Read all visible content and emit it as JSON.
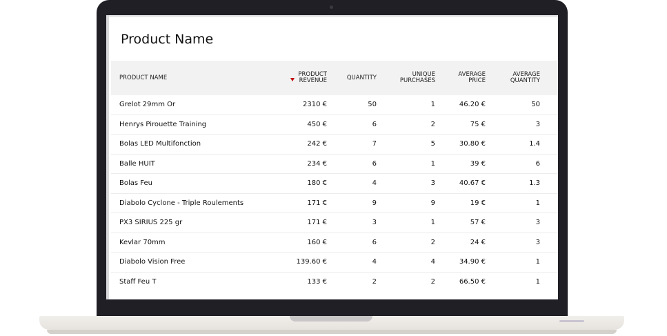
{
  "report": {
    "title": "Product Name",
    "sorted_column": "product_revenue",
    "sort_direction": "desc",
    "sort_indicator_color": "#c00000",
    "columns": [
      {
        "key": "name",
        "label": "PRODUCT NAME"
      },
      {
        "key": "revenue",
        "label": "PRODUCT\nREVENUE"
      },
      {
        "key": "quantity",
        "label": "QUANTITY"
      },
      {
        "key": "unique",
        "label": "UNIQUE\nPURCHASES"
      },
      {
        "key": "avg_price",
        "label": "AVERAGE\nPRICE"
      },
      {
        "key": "avg_qty",
        "label": "AVERAGE\nQUANTITY"
      }
    ],
    "rows": [
      {
        "name": "Grelot 29mm Or",
        "revenue": "2310 €",
        "quantity": "50",
        "unique": "1",
        "avg_price": "46.20 €",
        "avg_qty": "50"
      },
      {
        "name": "Henrys Pirouette Training",
        "revenue": "450 €",
        "quantity": "6",
        "unique": "2",
        "avg_price": "75 €",
        "avg_qty": "3"
      },
      {
        "name": "Bolas LED Multifonction",
        "revenue": "242 €",
        "quantity": "7",
        "unique": "5",
        "avg_price": "30.80 €",
        "avg_qty": "1.4"
      },
      {
        "name": "Balle HUIT",
        "revenue": "234 €",
        "quantity": "6",
        "unique": "1",
        "avg_price": "39 €",
        "avg_qty": "6"
      },
      {
        "name": "Bolas Feu",
        "revenue": "180 €",
        "quantity": "4",
        "unique": "3",
        "avg_price": "40.67 €",
        "avg_qty": "1.3"
      },
      {
        "name": "Diabolo Cyclone - Triple Roulements",
        "revenue": "171 €",
        "quantity": "9",
        "unique": "9",
        "avg_price": "19 €",
        "avg_qty": "1"
      },
      {
        "name": "PX3 SIRIUS 225 gr",
        "revenue": "171 €",
        "quantity": "3",
        "unique": "1",
        "avg_price": "57 €",
        "avg_qty": "3"
      },
      {
        "name": "Kevlar 70mm",
        "revenue": "160 €",
        "quantity": "6",
        "unique": "2",
        "avg_price": "24 €",
        "avg_qty": "3"
      },
      {
        "name": "Diabolo Vision Free",
        "revenue": "139.60 €",
        "quantity": "4",
        "unique": "4",
        "avg_price": "34.90 €",
        "avg_qty": "1"
      },
      {
        "name": "Staff Feu T",
        "revenue": "133 €",
        "quantity": "2",
        "unique": "2",
        "avg_price": "66.50 €",
        "avg_qty": "1"
      }
    ]
  }
}
